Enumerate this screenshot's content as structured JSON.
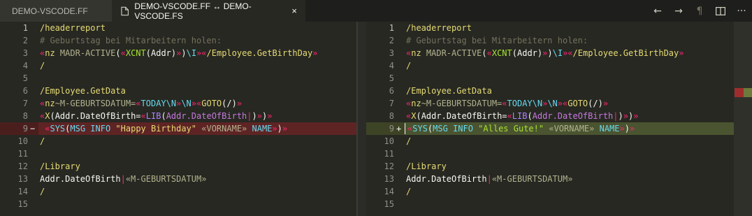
{
  "tabs": [
    {
      "label": "DEMO-VSCODE.FF"
    },
    {
      "label": "DEMO-VSCODE.FF ↔ DEMO-VSCODE.FS",
      "close": "×"
    }
  ],
  "toolbar": {
    "prev": "←",
    "next": "→",
    "whitespace": "¶",
    "split": "◫",
    "more": "···"
  },
  "editor": {
    "left": {
      "line_numbers": [
        "1",
        "2",
        "3",
        "4",
        "5",
        "6",
        "7",
        "8",
        "9",
        "10",
        "11",
        "12",
        "13",
        "14",
        "15"
      ],
      "diff_marker": "−",
      "lines": [
        [
          "/headerreport"
        ],
        [
          "# Geburtstag bei Mitarbeitern holen:"
        ],
        [
          "«",
          "nz",
          " MADR-ACTIVE",
          "(",
          "«",
          "XCNT",
          "(",
          "Addr",
          ")",
          "»",
          ")",
          "\\I",
          "»",
          "«",
          "/Employee.GetBirthDay",
          "»"
        ],
        [
          "/"
        ],
        [
          ""
        ],
        [
          "/Employee.GetData"
        ],
        [
          "«",
          "nz",
          "~M-GEBURTSDATUM=",
          "«",
          "TODAY",
          "\\N",
          "»",
          "\\N",
          "»",
          "«",
          "GOTO",
          "(/)",
          "»"
        ],
        [
          "«",
          "X",
          "(",
          "Addr.DateOfBirth=",
          "«",
          "LIB",
          "(",
          "Addr.DateOfBirth",
          "|",
          ")",
          "»",
          ")",
          "»"
        ],
        [
          " ",
          "«",
          "SYS",
          "(",
          "MSG INFO ",
          "\"Happy Birthday\"",
          " ",
          "«VORNAME»",
          " NAME",
          "»",
          ")",
          "»"
        ],
        [
          "/"
        ],
        [
          ""
        ],
        [
          "/Library"
        ],
        [
          "Addr.DateOfBirth",
          "|",
          "«M-GEBURTSDATUM»"
        ],
        [
          "/"
        ],
        [
          ""
        ]
      ]
    },
    "right": {
      "line_numbers": [
        "1",
        "2",
        "3",
        "4",
        "5",
        "6",
        "7",
        "8",
        "9",
        "10",
        "11",
        "12",
        "13",
        "14",
        "15"
      ],
      "diff_marker": "+",
      "lines": [
        [
          "/headerreport"
        ],
        [
          "# Geburtstag bei Mitarbeitern holen:"
        ],
        [
          "«",
          "nz",
          " MADR-ACTIVE",
          "(",
          "«",
          "XCNT",
          "(",
          "Addr",
          ")",
          "»",
          ")",
          "\\I",
          "»",
          "«",
          "/Employee.GetBirthDay",
          "»"
        ],
        [
          "/"
        ],
        [
          ""
        ],
        [
          "/Employee.GetData"
        ],
        [
          "«",
          "nz",
          "~M-GEBURTSDATUM=",
          "«",
          "TODAY",
          "\\N",
          "»",
          "\\N",
          "»",
          "«",
          "GOTO",
          "(/)",
          "»"
        ],
        [
          "«",
          "X",
          "(",
          "Addr.DateOfBirth=",
          "«",
          "LIB",
          "(",
          "Addr.DateOfBirth",
          "|",
          ")",
          "»",
          ")",
          "»"
        ],
        [
          "«",
          "SYS",
          "(",
          "MSG INFO ",
          "\"Alles Gute!\"",
          " ",
          "«VORNAME»",
          " NAME",
          "»",
          ")",
          "»"
        ],
        [
          "/"
        ],
        [
          ""
        ],
        [
          "/Library"
        ],
        [
          "Addr.DateOfBirth",
          "|",
          "«M-GEBURTSDATUM»"
        ],
        [
          "/"
        ],
        [
          ""
        ]
      ]
    }
  },
  "colors": {
    "background": "#272822",
    "deleted": "#5e2424",
    "inserted": "#4a5430",
    "keyword": "#e6db74",
    "comment": "#75715e"
  }
}
